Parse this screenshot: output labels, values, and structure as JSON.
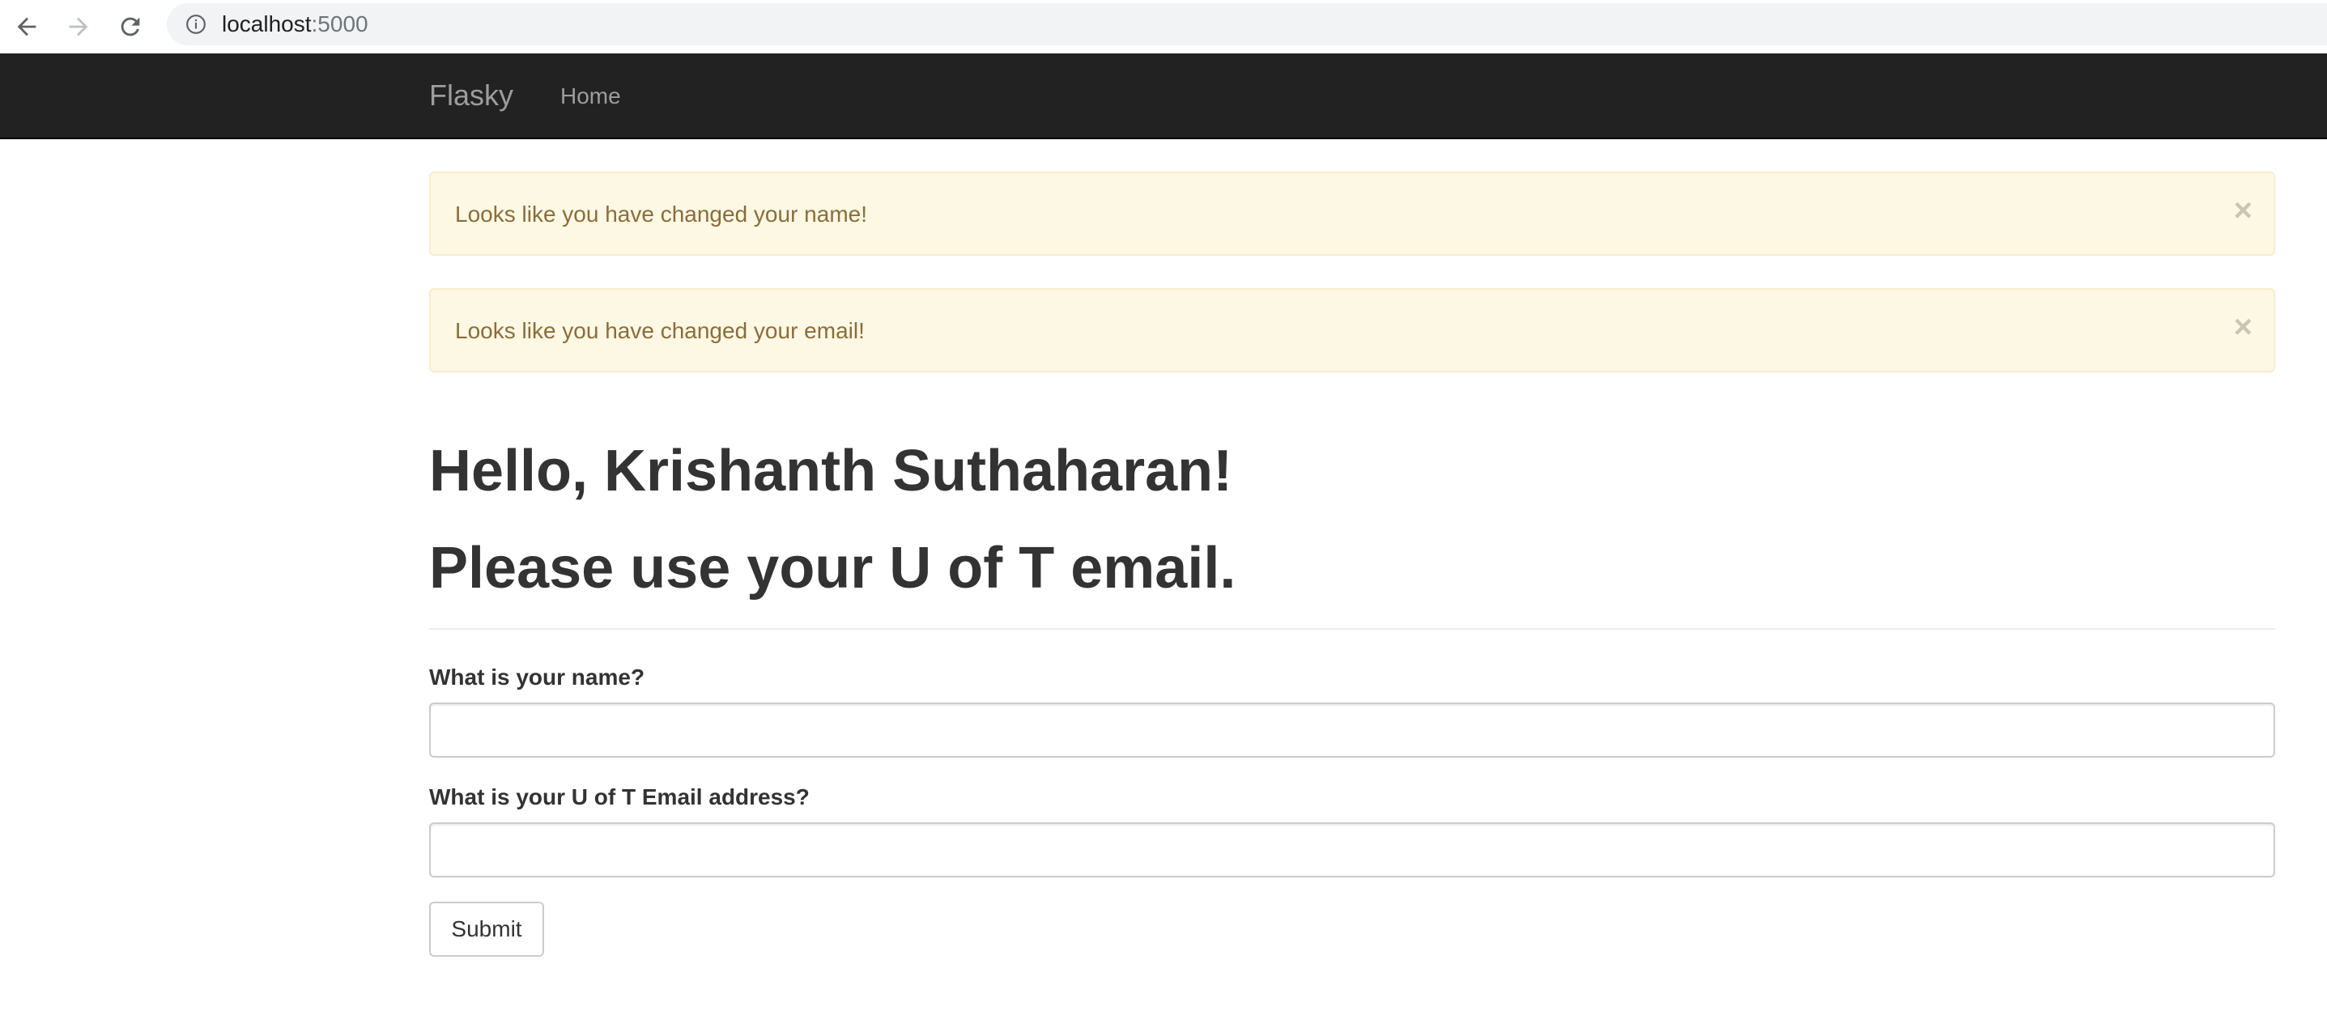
{
  "browser": {
    "url_host": "localhost",
    "url_port": ":5000"
  },
  "navbar": {
    "brand": "Flasky",
    "links": [
      {
        "label": "Home"
      }
    ]
  },
  "alerts": [
    {
      "text": "Looks like you have changed your name!",
      "close": "×"
    },
    {
      "text": "Looks like you have changed your email!",
      "close": "×"
    }
  ],
  "header": {
    "greeting": "Hello, Krishanth Suthaharan!",
    "notice": "Please use your U of T email."
  },
  "form": {
    "name_label": "What is your name?",
    "name_value": "",
    "email_label": "What is your U of T Email address?",
    "email_value": "",
    "submit_label": "Submit"
  }
}
